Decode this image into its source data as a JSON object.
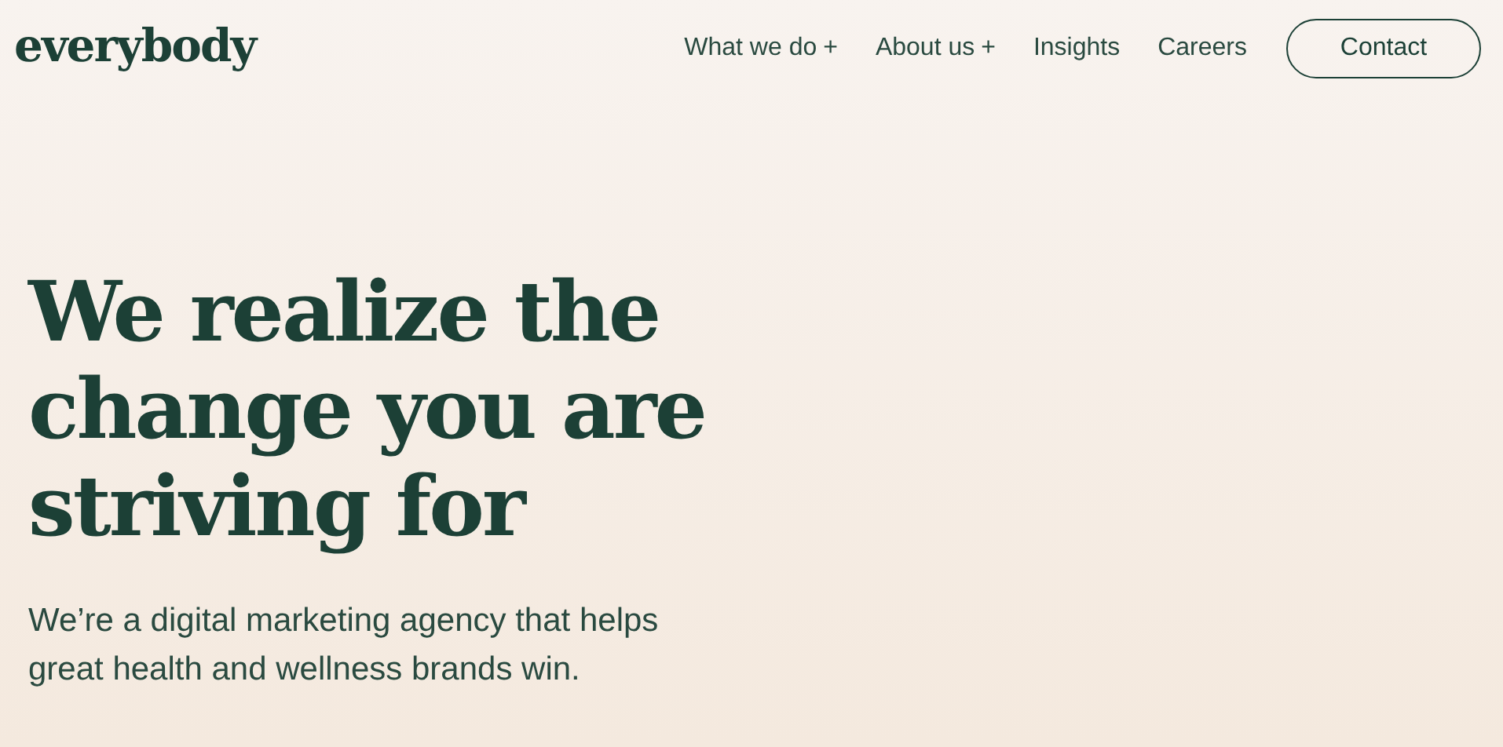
{
  "header": {
    "logo": "everybody",
    "nav": [
      {
        "label": "What we do",
        "indicator": "+"
      },
      {
        "label": "About us",
        "indicator": "+"
      },
      {
        "label": "Insights"
      },
      {
        "label": "Careers"
      }
    ],
    "contact_button": "Contact"
  },
  "hero": {
    "heading": "We realize the change you are striving for",
    "subheading": "We’re a digital marketing agency that helps great health and wellness brands win."
  }
}
